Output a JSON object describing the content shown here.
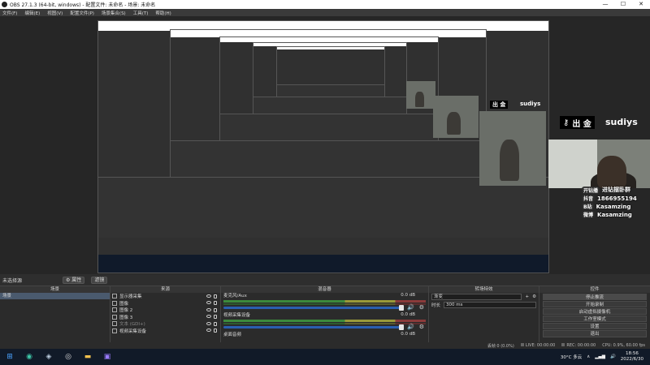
{
  "window": {
    "title": "OBS 27.1.3 (64-bit, windows) - 配置文件: 未命名 - 场景: 未命名",
    "minimize": "—",
    "maximize": "☐",
    "close": "✕"
  },
  "menu": [
    "文件(F)",
    "编辑(E)",
    "视图(V)",
    "配置文件(P)",
    "场景集合(S)",
    "工具(T)",
    "帮助(H)"
  ],
  "preview": {
    "overlay_title_large": "出 金",
    "overlay_name_large": "sudiys",
    "overlay_title_small": "出 金",
    "overlay_name_small": "sudiys",
    "info": [
      {
        "pill": "开钻播",
        "value": "进钻摆卧群"
      },
      {
        "pill": "抖音",
        "value": "1866955194"
      },
      {
        "pill": "B站",
        "value": "Kasamzing"
      },
      {
        "pill": "微博",
        "value": "Kasamzing"
      }
    ]
  },
  "scene_bar": {
    "label": "未选择源",
    "properties_button": "⚙ 属性",
    "filters_button": "滤镜"
  },
  "scenes_dock": {
    "title": "场景",
    "items": [
      "场景"
    ],
    "footer": [
      "+",
      "−",
      "∧",
      "∨"
    ]
  },
  "sources_dock": {
    "title": "来源",
    "items": [
      {
        "label": "显示器采集"
      },
      {
        "label": "图像"
      },
      {
        "label": "图像 2"
      },
      {
        "label": "图像 3"
      },
      {
        "label": "文本 (GDI+)"
      },
      {
        "label": "视频采集设备"
      }
    ],
    "footer": [
      "+",
      "−",
      "⚙",
      "∧",
      "∨"
    ]
  },
  "mixer_dock": {
    "title": "混音器",
    "channels": [
      {
        "name": "麦克风/Aux",
        "db": "0.0 dB"
      },
      {
        "name": "视频采集设备",
        "db": "0.0 dB"
      },
      {
        "name": "桌面音频",
        "db": "0.0 dB"
      }
    ]
  },
  "transitions_dock": {
    "title": "转场特效",
    "transition": "渐变",
    "duration_label": "时长",
    "duration": "300 ms"
  },
  "controls_dock": {
    "title": "控件",
    "buttons": [
      "停止推流",
      "开始录制",
      "启动虚拟摄像机",
      "工作室模式",
      "设置",
      "退出"
    ]
  },
  "status": {
    "dropped": "丢帧 0 (0.0%)",
    "live": "LIVE: 00:00:00",
    "rec": "REC: 00:00:00",
    "cpu": "CPU: 0.9%, 60.00 fps"
  },
  "taskbar": {
    "weather": "30°C 多云",
    "time": "18:56",
    "date": "2022/6/30"
  },
  "colors": {
    "accent": "#2a5fb0",
    "panel": "#2b2b2b",
    "taskbar": "#111a28"
  }
}
